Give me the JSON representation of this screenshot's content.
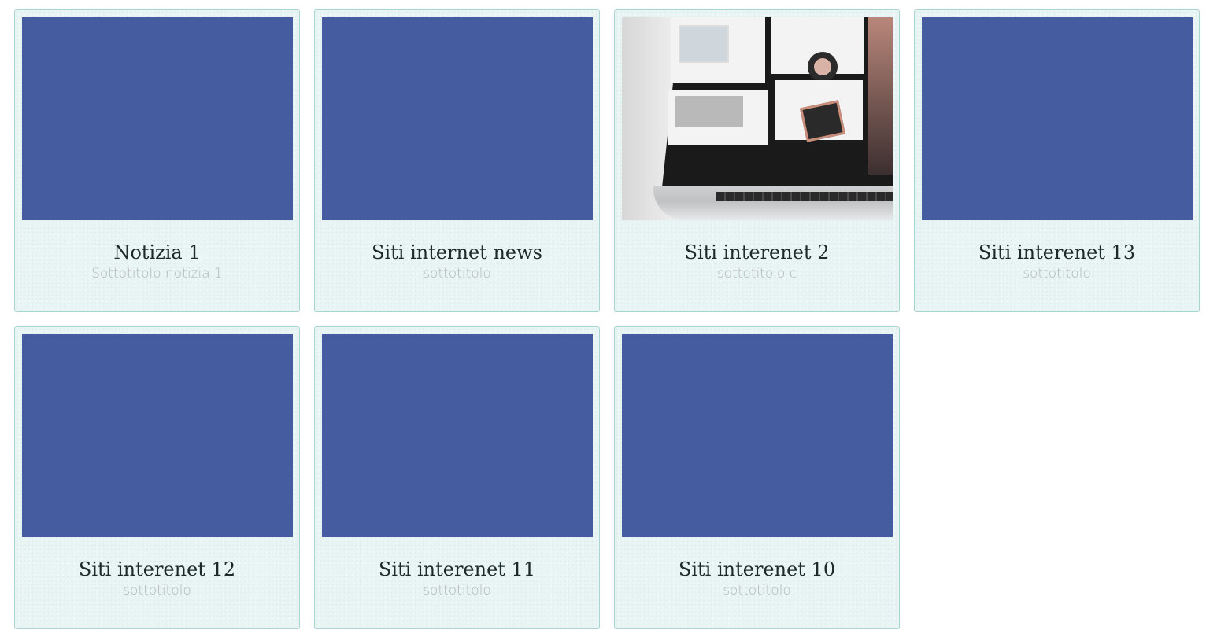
{
  "cards": [
    {
      "title": "Notizia 1",
      "subtitle": "Sottotitolo notizia 1",
      "thumbnail_color": "#465ca1",
      "has_photo": false
    },
    {
      "title": "Siti internet news",
      "subtitle": "sottotitolo",
      "thumbnail_color": "#465ca1",
      "has_photo": false
    },
    {
      "title": "Siti interenet 2",
      "subtitle": "sottotitolo c",
      "thumbnail_color": null,
      "has_photo": true
    },
    {
      "title": "Siti interenet 13",
      "subtitle": "sottotitolo",
      "thumbnail_color": "#465ca1",
      "has_photo": false
    },
    {
      "title": "Siti interenet 12",
      "subtitle": "sottotitolo",
      "thumbnail_color": "#465ca1",
      "has_photo": false
    },
    {
      "title": "Siti interenet 11",
      "subtitle": "sottotitolo",
      "thumbnail_color": "#465ca1",
      "has_photo": false
    },
    {
      "title": "Siti interenet 10",
      "subtitle": "sottotitolo",
      "thumbnail_color": "#465ca1",
      "has_photo": false
    }
  ],
  "colors": {
    "card_background": "#e8f5f4",
    "card_border": "#a9d4d2",
    "placeholder": "#465ca1",
    "title_text": "#1d2a2a",
    "subtitle_text": "#b3b6b6"
  }
}
